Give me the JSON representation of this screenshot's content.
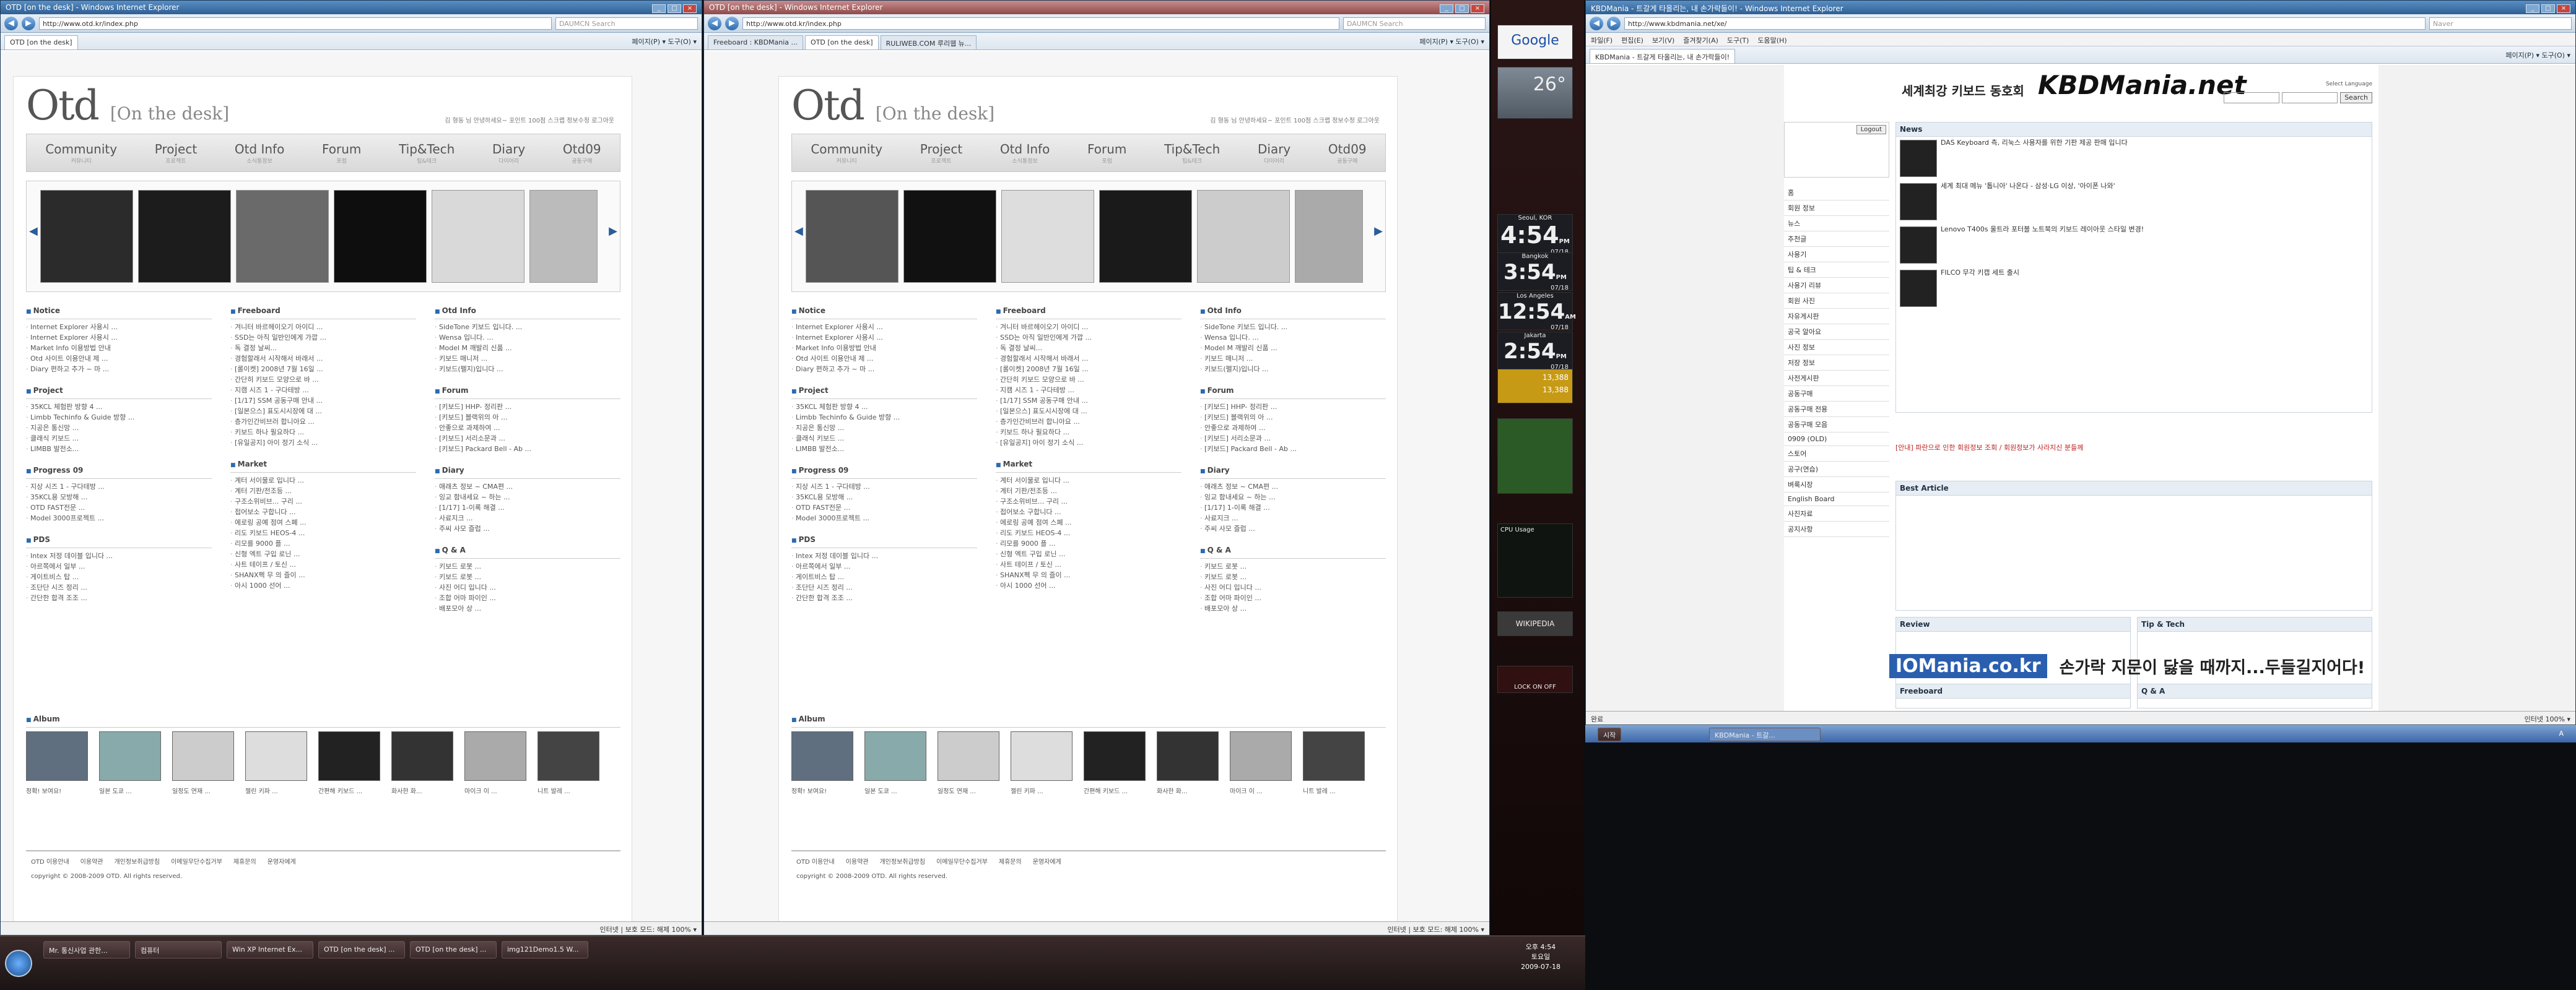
{
  "left_ie": {
    "title": "OTD [on the desk] - Windows Internet Explorer",
    "url": "http://www.otd.kr/index.php",
    "search_placeholder": "DAUMCN Search",
    "tab": "OTD [on the desk]",
    "tb_right": "페이지(P) ▾  도구(O) ▾",
    "status_left": "",
    "status_right": "인터넷 | 보호 모드: 해제    100% ▾"
  },
  "mid_ie": {
    "title": "OTD [on the desk] - Windows Internet Explorer",
    "url": "http://www.otd.kr/index.php",
    "search_placeholder": "DAUMCN Search",
    "tabs": [
      "Freeboard : KBDMania ...",
      "OTD [on the desk]",
      "RULIWEB.COM 루리웹 뉴..."
    ],
    "tb_right": "페이지(P) ▾  도구(O) ▾",
    "status_right": "인터넷 | 보호 모드: 해제    100% ▾"
  },
  "otd": {
    "logo": "Otd",
    "logo_sub": "[On the desk]",
    "top_links": "김 형동 님 안녕하세요~  포인트 100점  스크랩  정보수정  로그아웃",
    "nav": [
      {
        "label": "Community",
        "sub": "커뮤니티"
      },
      {
        "label": "Project",
        "sub": "프로젝트"
      },
      {
        "label": "Otd Info",
        "sub": "소식통정보"
      },
      {
        "label": "Forum",
        "sub": "포럼"
      },
      {
        "label": "Tip&Tech",
        "sub": "팁&테크"
      },
      {
        "label": "Diary",
        "sub": "다이어리"
      },
      {
        "label": "Otd09",
        "sub": "공동구매"
      }
    ],
    "cols": [
      {
        "title": "Notice",
        "items": [
          "Internet Explorer 사용시 ...",
          "Internet Explorer 사용시 ...",
          "Market Info 이용방법 안내",
          "Otd 사이트 이용안내 제 ...",
          "Diary 편하고 추가 ~ 마 ..."
        ]
      },
      {
        "title": "Freeboard",
        "items": [
          "겨니터 바르헤이오기 아이디 ...",
          "SSD는 아직 일반인에게 가깝 ...",
          "독 결정 날씨...",
          "경험할래서 시작해서 바래서 ...",
          "[롤이켓] 2008년 7월 16일 ...",
          "간단히 키보드 모양으로 바 ...",
          "지캠 시즈 1 - 구다테방 ...",
          "[1/17] SSM 공동구매 안내 ...",
          "[일본으스] 표도시시장에 대 ...",
          "층가인간비브러 합니아요 ...",
          "키보드 하나 필요하다 ...",
          "[유일공지] 아이 정기 소식 ..."
        ]
      },
      {
        "title": "Otd Info",
        "items": [
          "SideTone 키보드 입니다. ...",
          "Wensa 입니다. ...",
          "Model M 깨발리 신품 ...",
          "키보드 매니저 ...",
          "키보드(펠지)입니다 ..."
        ]
      },
      {
        "title": "Project",
        "items": [
          "35KCL 체험판 방향 4 ...",
          "Limbb Techinfo & Guide 방향 ...",
          "지공은 통신망 ...",
          "클래식 키보드 ...",
          "LIMBB 발전소..."
        ]
      },
      {
        "title": "Forum",
        "items": [
          "[키보드] HHP- 정리판 ...",
          "[키보드] 블랙위의 아 ...",
          "안좋으로 과제하여 ...",
          "[키보드] 서리소문과 ...",
          "[키보드] Packard Bell - Ab ..."
        ]
      },
      {
        "title": "Progress 09",
        "items": [
          "지상 시즈 1 - 구다테방 ...",
          "35KCL용 모방해 ...",
          "OTD FAST전문 ...",
          "Model 3000프로젝트 ..."
        ]
      },
      {
        "title": "Market",
        "items": [
          "계터 서이물로 입니다 ...",
          "계터 기판/전조등 ...",
          "구조소위비브... 구리 ...",
          "접어보소 구합니다 ...",
          "에로링 공예 점여 스폐 ...",
          "리도 키보드 HEOS-4 ...",
          "리모를 9000 플 ...",
          "신형 엑트 구입 로닌 ...",
          "사트 테이프 / 토신 ...",
          "SHANX펙 무 의 즐이 ...",
          "아시 1000 선어 ..."
        ]
      },
      {
        "title": "Diary",
        "items": [
          "애래츠 정보 ~ CMA편 ...",
          "잉교 함내세요 ~ 하는 ...",
          "[1/17] 1-이록 해결 ...",
          "사료지크 ...",
          "주씨 사모 즐럽 ..."
        ]
      },
      {
        "title": "PDS",
        "items": [
          "Intex 저정 데이블 입니다 ...",
          "아르쪽에서 일부 ...",
          "게이트비스 탑 ...",
          "조단단 시즈 정리 ...",
          "간단한 합격 조조 ..."
        ]
      },
      {
        "title": "Q & A",
        "items": [
          "키보드 로봇 ...",
          "키보드 로봇 ...",
          "사진 어디 입니다 ...",
          "조합 어마 파이인 ...",
          "배포모아 상 ..."
        ]
      }
    ],
    "album_title": "Album",
    "album_captions": [
      "정확! 보여요!",
      "일본 도쿄 ...",
      "일정도 연재 ...",
      "젤린 키파 ...",
      "간편해 키보드 ...",
      "화사한 화...",
      "마이크 이 ...",
      "니트 발레 ..."
    ],
    "footer_links": [
      "OTD 이용안내",
      "이용약관",
      "개인정보취급방침",
      "이메일무단수집거부",
      "제휴문의",
      "운영자에게"
    ],
    "copyright": "copyright © 2008-2009 OTD. All rights reserved."
  },
  "right_ie": {
    "title": "KBDMania - 트갈게 타올리는, 내 손가락들이! - Windows Internet Explorer",
    "url": "http://www.kbdmania.net/xe/",
    "search_placeholder": "Naver",
    "menu": [
      "파일(F)",
      "편집(E)",
      "보기(V)",
      "즐겨찾기(A)",
      "도구(T)",
      "도움말(H)"
    ],
    "tab": "KBDMania - 트갈게 타올리는, 내 손가락들이!",
    "tb_right": "페이지(P) ▾  도구(O) ▾",
    "status_left": "완료",
    "status_right": "인터넷    100% ▾"
  },
  "kbd": {
    "slogan": "세계최강 키보드 동호회",
    "logo": "KBDMania.net",
    "search_label": "Search",
    "select_lang": "Select Language",
    "logout": "Logout",
    "side_items": [
      "홈",
      "회원 정보",
      "뉴스",
      "추천글",
      "사용기",
      "팁 & 테크",
      "사용기 리뷰",
      "회원 사진",
      "자유게시판",
      "공국 알아요",
      "사진 정보",
      "저장 정보",
      "사전게시판",
      "공동구매",
      "공동구매 전용",
      "공동구매 모음",
      "0909 (OLD)",
      "스토어",
      "공구(연습)",
      "벼룩시장",
      "English Board",
      "사진자료",
      "공지사항"
    ],
    "news_title": "News",
    "news": [
      "DAS Keyboard 측, 리눅스 사용자를 위한 기판 제공 판매 입니다",
      "세계 최대 메뉴 '톱니아' 나온다 - 삼성·LG 이상, '아이폰 나와'",
      "Lenovo T400s 울트라 포터블 노트북의 키보드 레이아웃 스타일 변경!",
      "FILCO 무각 키캡 세트 출시"
    ],
    "notice": "[안내] 파란으로 인한 회원정보 조회 / 회원정보가 사라지신 분들께",
    "best_title": "Best Article",
    "review_title": "Review",
    "tip_title": "Tip & Tech",
    "freeboard_title": "Freeboard",
    "qa_title": "Q & A",
    "banner_logo": "IOMania.co.kr",
    "banner_text": "손가락 지문이 닳을 때까지...두들길지어다!"
  },
  "gadgets": {
    "google": "Google",
    "temp": "26°",
    "cpu_label": "CPU Usage",
    "wiki": "WIKIPEDIA",
    "lock": "LOCK ON OFF",
    "clocks": [
      {
        "city": "Seoul, KOR",
        "time": "4:54",
        "ampm": "PM",
        "date": "07/18"
      },
      {
        "city": "Bangkok",
        "time": "3:54",
        "ampm": "PM",
        "date": "07/18"
      },
      {
        "city": "Los Angeles",
        "time": "12:54",
        "ampm": "AM",
        "date": "07/18"
      },
      {
        "city": "Jakarta",
        "time": "2:54",
        "ampm": "PM",
        "date": "07/18"
      }
    ],
    "stock1": "13,388",
    "stock2": "13,388"
  },
  "taskbar": {
    "buttons": [
      "Mr. 통신사업 관한...",
      "컴퓨터",
      "Win XP Internet Ex...",
      "OTD [on the desk] ...",
      "OTD [on the desk] ...",
      "img121Demo1.5 W..."
    ],
    "time": "오후 4:54",
    "day": "토요일",
    "date": "2009-07-18",
    "right_buttons": [
      "KBDMania - 트갈...",
      "시작"
    ],
    "right_lang": "A"
  }
}
